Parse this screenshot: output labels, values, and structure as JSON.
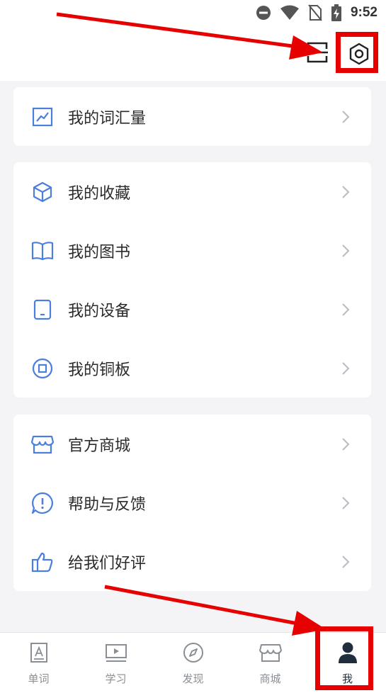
{
  "status_bar": {
    "time": "9:52",
    "icons": [
      "do-not-disturb-icon",
      "wifi-icon",
      "no-sim-icon",
      "battery-charging-icon"
    ]
  },
  "header": {
    "scan_icon": "scan-icon",
    "settings_icon": "settings-hexagon-icon"
  },
  "menu": {
    "vocab": {
      "label": "我的词汇量",
      "icon": "chart-line-icon"
    },
    "group2": [
      {
        "label": "我的收藏",
        "icon": "cube-icon"
      },
      {
        "label": "我的图书",
        "icon": "book-icon"
      },
      {
        "label": "我的设备",
        "icon": "device-icon"
      },
      {
        "label": "我的铜板",
        "icon": "coin-icon"
      }
    ],
    "group3": [
      {
        "label": "官方商城",
        "icon": "store-icon"
      },
      {
        "label": "帮助与反馈",
        "icon": "help-feedback-icon"
      },
      {
        "label": "给我们好评",
        "icon": "thumbs-up-icon"
      }
    ]
  },
  "tabs": [
    {
      "label": "单词",
      "icon": "word-card-icon",
      "active": false
    },
    {
      "label": "学习",
      "icon": "video-play-icon",
      "active": false
    },
    {
      "label": "发现",
      "icon": "compass-icon",
      "active": false
    },
    {
      "label": "商城",
      "icon": "store-icon",
      "active": false
    },
    {
      "label": "我",
      "icon": "person-icon",
      "active": true
    }
  ],
  "colors": {
    "accent_blue": "#4a7fe0",
    "highlight_red": "#e60000",
    "icon_dark": "#1f2d3d",
    "tab_gray": "#8a8f96"
  }
}
